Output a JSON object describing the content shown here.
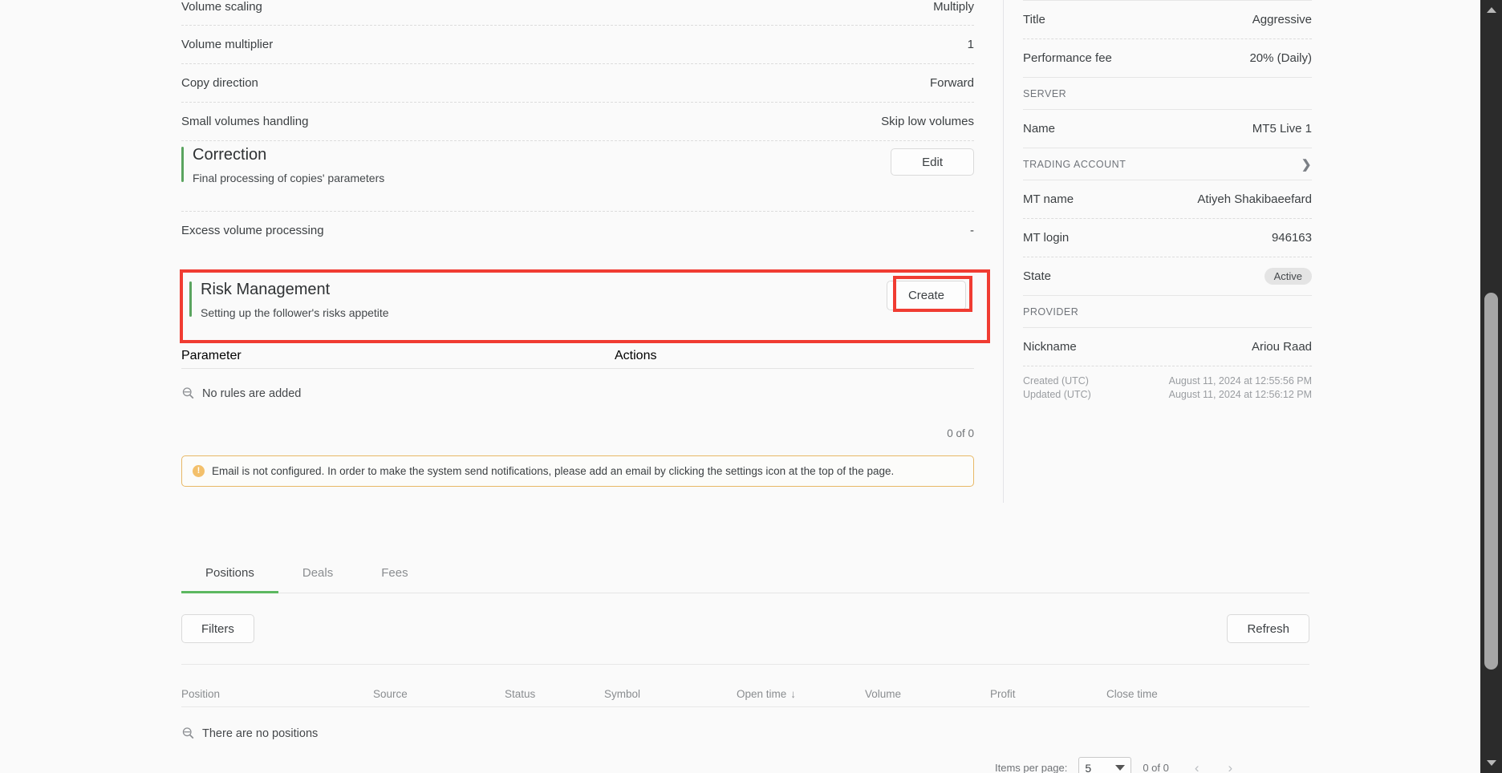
{
  "settings_rows": [
    {
      "label": "Volume scaling",
      "value": "Multiply"
    },
    {
      "label": "Volume multiplier",
      "value": "1"
    },
    {
      "label": "Copy direction",
      "value": "Forward"
    },
    {
      "label": "Small volumes handling",
      "value": "Skip low volumes"
    }
  ],
  "correction": {
    "title": "Correction",
    "subtitle": "Final processing of copies' parameters",
    "edit_label": "Edit",
    "row": {
      "label": "Excess volume processing",
      "value": "-"
    }
  },
  "risk_management": {
    "title": "Risk Management",
    "subtitle": "Setting up the follower's risks appetite",
    "create_label": "Create"
  },
  "rules_table": {
    "columns": [
      "Parameter",
      "Actions"
    ],
    "empty_text": "No rules are added",
    "count": "0 of 0"
  },
  "alert": {
    "icon": "warning-icon",
    "text": "Email is not configured. In order to make the system send notifications, please add an email by clicking the settings icon at the top of the page."
  },
  "tabs": [
    {
      "label": "Positions",
      "active": true
    },
    {
      "label": "Deals",
      "active": false
    },
    {
      "label": "Fees",
      "active": false
    }
  ],
  "toolbar": {
    "filters_label": "Filters",
    "refresh_label": "Refresh"
  },
  "positions_table": {
    "columns": [
      "Position",
      "Source",
      "Status",
      "Symbol",
      "Open time",
      "Volume",
      "Profit",
      "Close time"
    ],
    "sorted_column": "Open time",
    "sort_direction": "desc",
    "sort_glyph": "↓",
    "empty_text": "There are no positions"
  },
  "paginator": {
    "items_per_page_label": "Items per page:",
    "items_per_page_value": "5",
    "range_label": "0 of 0",
    "prev_glyph": "‹",
    "next_glyph": "›"
  },
  "sidebar": {
    "rows_top": [
      {
        "label": "Title",
        "value": "Aggressive"
      },
      {
        "label": "Performance fee",
        "value": "20% (Daily)"
      }
    ],
    "group_server": "SERVER",
    "server_rows": [
      {
        "label": "Name",
        "value": "MT5 Live 1"
      }
    ],
    "group_trading_account": "TRADING ACCOUNT",
    "trading_rows": [
      {
        "label": "MT name",
        "value": "Atiyeh Shakibaeefard"
      },
      {
        "label": "MT login",
        "value": "946163"
      }
    ],
    "state": {
      "label": "State",
      "value": "Active"
    },
    "group_provider": "PROVIDER",
    "provider_rows": [
      {
        "label": "Nickname",
        "value": "Ariou Raad"
      }
    ],
    "meta": [
      {
        "label": "Created (UTC)",
        "value": "August 11, 2024 at 12:55:56 PM"
      },
      {
        "label": "Updated (UTC)",
        "value": "August 11, 2024 at 12:56:12 PM"
      }
    ]
  },
  "colors": {
    "accent_green": "#5cb860",
    "highlight_red": "#f03c32",
    "alert_border": "#e8b866",
    "page_bg": "#fafafa",
    "scrollbar_track": "#2b2b2b",
    "scrollbar_thumb": "#a6a6a6"
  }
}
